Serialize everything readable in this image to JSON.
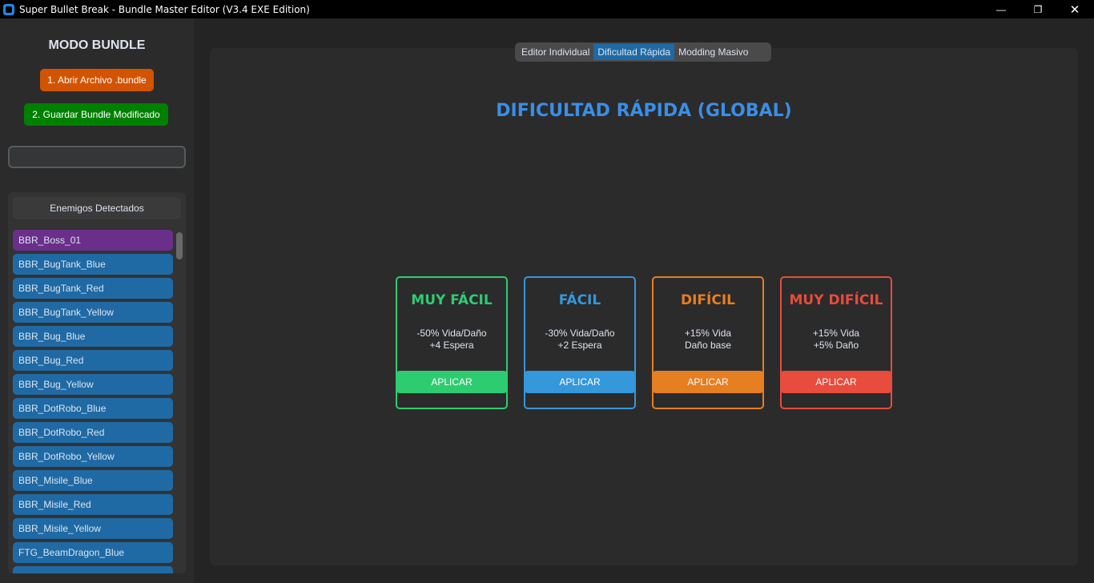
{
  "window": {
    "title": "Super Bullet Break - Bundle Master Editor (V3.4 EXE Edition)"
  },
  "sidebar": {
    "mode_title": "MODO BUNDLE",
    "open_button": "1. Abrir Archivo .bundle",
    "save_button": "2. Guardar Bundle Modificado",
    "search_value": "",
    "list_header": "Enemigos Detectados",
    "items": [
      "BBR_Boss_01",
      "BBR_BugTank_Blue",
      "BBR_BugTank_Red",
      "BBR_BugTank_Yellow",
      "BBR_Bug_Blue",
      "BBR_Bug_Red",
      "BBR_Bug_Yellow",
      "BBR_DotRobo_Blue",
      "BBR_DotRobo_Red",
      "BBR_DotRobo_Yellow",
      "BBR_Misile_Blue",
      "BBR_Misile_Red",
      "BBR_Misile_Yellow",
      "FTG_BeamDragon_Blue"
    ],
    "selected_color": "#6a2f8a"
  },
  "tabs": [
    {
      "label": "Editor Individual"
    },
    {
      "label": "Dificultad Rápida",
      "selected": true
    },
    {
      "label": "Modding Masivo"
    }
  ],
  "main": {
    "heading": "DIFICULTAD RÁPIDA (GLOBAL)",
    "cards": [
      {
        "title": "MUY FÁCIL",
        "line1": "-50% Vida/Daño",
        "line2": "+4 Espera",
        "button": "APLICAR",
        "color": "#2ecc71"
      },
      {
        "title": "FÁCIL",
        "line1": "-30% Vida/Daño",
        "line2": "+2 Espera",
        "button": "APLICAR",
        "color": "#3498db"
      },
      {
        "title": "DIFÍCIL",
        "line1": "+15% Vida",
        "line2": "Daño base",
        "button": "APLICAR",
        "color": "#e67e22"
      },
      {
        "title": "MUY DIFÍCIL",
        "line1": "+15% Vida",
        "line2": "+5% Daño",
        "button": "APLICAR",
        "color": "#e74c3c"
      }
    ]
  }
}
